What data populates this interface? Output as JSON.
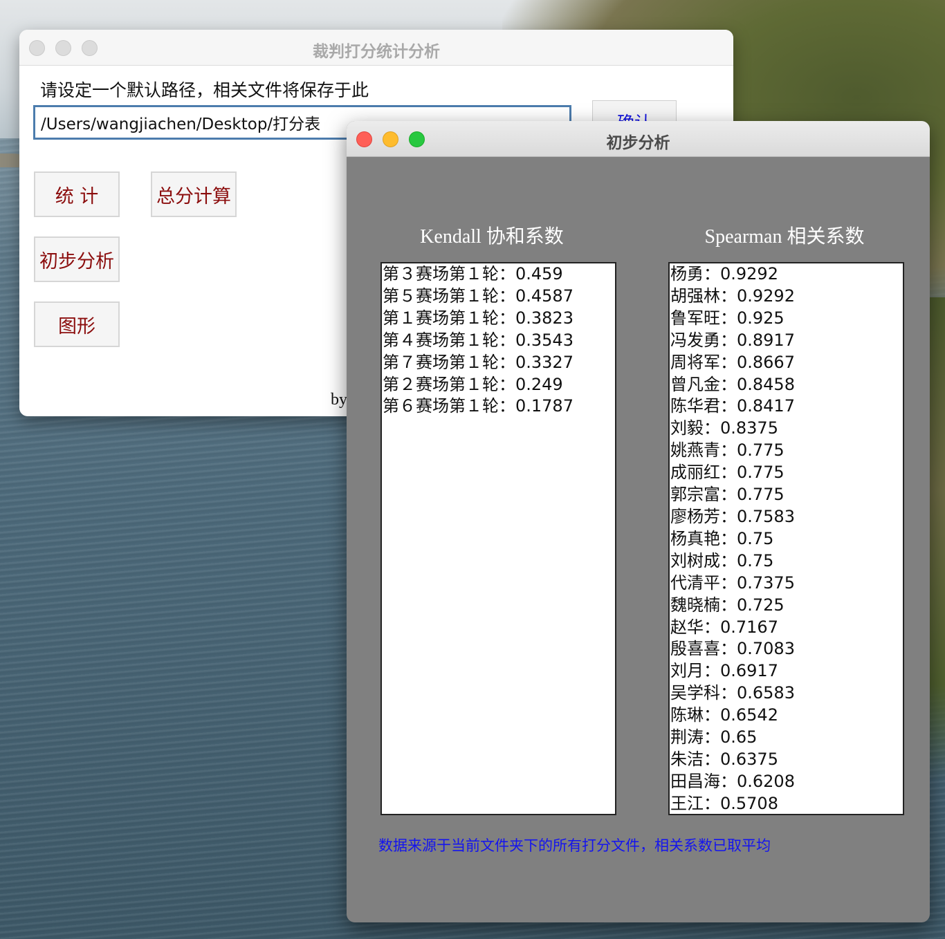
{
  "main_window": {
    "title": "裁判打分统计分析",
    "path_label": "请设定一个默认路径，相关文件将保存于此",
    "path_value": "/Users/wangjiachen/Desktop/打分表",
    "confirm_label": "确认",
    "buttons": {
      "stats": "统 计",
      "total": "总分计算",
      "analysis": "初步分析",
      "graph": "图形"
    },
    "by_text": "by"
  },
  "analysis_window": {
    "title": "初步分析",
    "kendall_header": "Kendall 协和系数",
    "spearman_header": "Spearman 相关系数",
    "kendall_items": [
      "第３赛场第１轮：0.459",
      "第５赛场第１轮：0.4587",
      "第１赛场第１轮：0.3823",
      "第４赛场第１轮：0.3543",
      "第７赛场第１轮：0.3327",
      "第２赛场第１轮：0.249",
      "第６赛场第１轮：0.1787"
    ],
    "spearman_items": [
      "杨勇：0.9292",
      "胡强林：0.9292",
      "鲁军旺：0.925",
      "冯发勇：0.8917",
      "周将军：0.8667",
      "曾凡金：0.8458",
      "陈华君：0.8417",
      "刘毅：0.8375",
      "姚燕青：0.775",
      "成丽红：0.775",
      "郭宗富：0.775",
      "廖杨芳：0.7583",
      "杨真艳：0.75",
      "刘树成：0.75",
      "代清平：0.7375",
      "魏晓楠：0.725",
      "赵华：0.7167",
      "殷喜喜：0.7083",
      "刘月：0.6917",
      "吴学科：0.6583",
      "陈琳：0.6542",
      "荆涛：0.65",
      "朱洁：0.6375",
      "田昌海：0.6208",
      "王江：0.5708"
    ],
    "footnote": "数据来源于当前文件夹下的所有打分文件，相关系数已取平均"
  }
}
